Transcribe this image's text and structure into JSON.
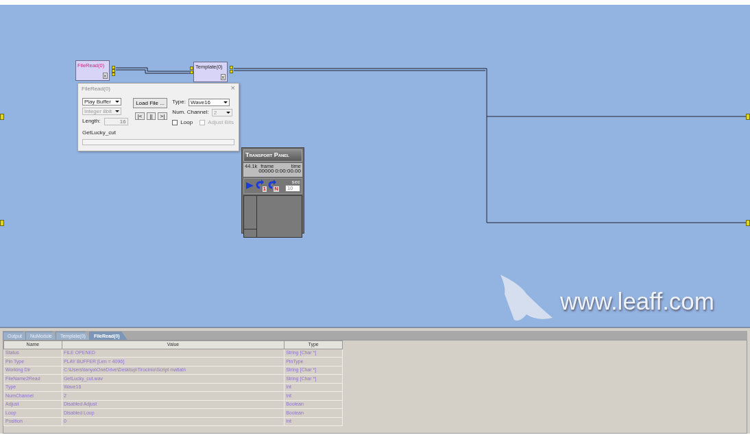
{
  "canvas": {
    "nodes": [
      {
        "title": "FileRead(0)",
        "highlighted": true,
        "close": "x"
      },
      {
        "title": "Template(0)",
        "highlighted": false,
        "close": "x"
      }
    ],
    "logo": "www.leaff.com"
  },
  "fileread_dialog": {
    "title": "FileRead(0)",
    "close": "×",
    "mode": "Play Buffer",
    "format": "Integer 8bit",
    "length_label": "Length:",
    "length": "16",
    "filename": "GetLucky_cut",
    "load_button": "Load File ...",
    "transport_buttons": [
      "|<",
      "||",
      ">|"
    ],
    "type_label": "Type:",
    "type": "Wave16",
    "channels_label": "Num. Channel:",
    "channels": "2",
    "loop": {
      "label": "Loop",
      "checked": false,
      "disabled": false
    },
    "adjust_bits": {
      "label": "Adjust Bits",
      "checked": false,
      "disabled": true
    }
  },
  "transport_panel": {
    "title": "Transport Panel",
    "rate": "44.1k",
    "frame_label": "frame",
    "frame": "00000",
    "time_label": "time",
    "time": "0:00:00.00",
    "repeat_one": "1",
    "repeat_n": "N",
    "sec_label": "sec",
    "sec": "10"
  },
  "bottom_panel": {
    "tabs": [
      {
        "label": "Output",
        "selected": false
      },
      {
        "label": "NuModule",
        "selected": false
      },
      {
        "label": "Template(0)",
        "selected": false
      },
      {
        "label": "FileRead(0)",
        "selected": true
      }
    ],
    "table": {
      "columns": [
        "Name",
        "Value",
        "Type"
      ],
      "rows": [
        [
          "Status",
          "FILE OPENED",
          "String [Char *]"
        ],
        [
          "Pin Type",
          "PLAY BUFFER [Len = 4096]",
          "PinType"
        ],
        [
          "Working Dir",
          "C:\\Users\\tanya\\OneDrive\\Desktop\\Tirocinio\\Script matlab\\",
          "String [Char *]"
        ],
        [
          "FileName2Read",
          "GetLucky_cut.wav",
          "String [Char *]"
        ],
        [
          "Type",
          "Wave16",
          "Int"
        ],
        [
          "NumChannel",
          "2",
          "Int"
        ],
        [
          "Adjust",
          "Disabled Adjust",
          "Boolean"
        ],
        [
          "Loop",
          "Disabled Loop",
          "Boolean"
        ],
        [
          "Position",
          "0",
          "Int"
        ]
      ]
    }
  }
}
